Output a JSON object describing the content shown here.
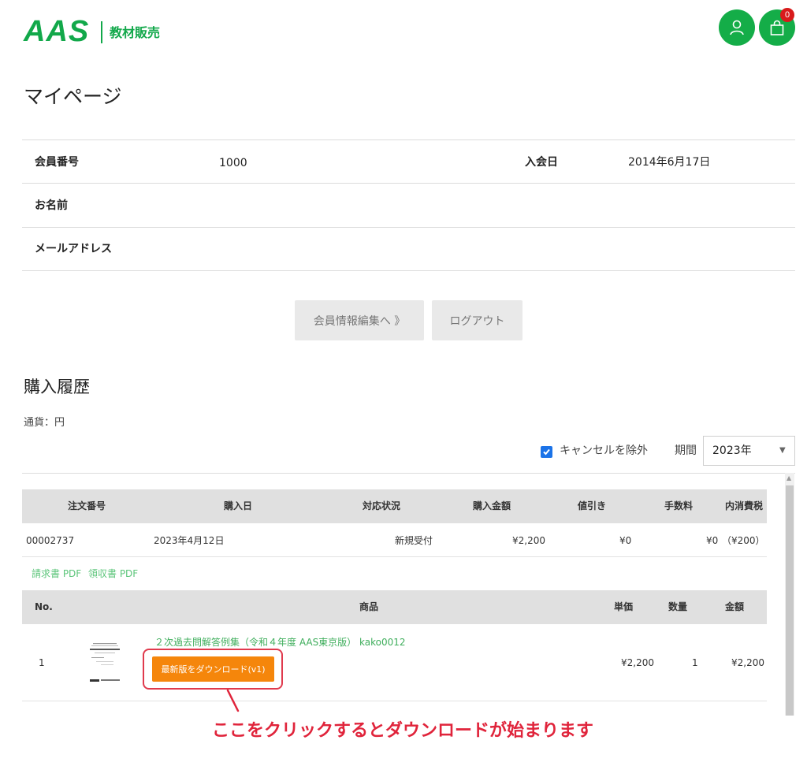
{
  "header": {
    "logo_text": "AAS",
    "logo_subtitle": "教材販売",
    "cart_count": "0",
    "brand_color": "#14ad48",
    "icons": [
      "user-icon",
      "shopping-bag-icon"
    ]
  },
  "page_title": "マイページ",
  "member": {
    "number_label": "会員番号",
    "number_value": "1000",
    "join_label": "入会日",
    "join_value": "2014年6月17日",
    "name_label": "お名前",
    "email_label": "メールアドレス"
  },
  "buttons": {
    "edit_member": "会員情報編集へ 》",
    "logout": "ログアウト"
  },
  "history": {
    "title": "購入履歴",
    "currency": "通貨：円",
    "exclude_cancel_label": "キャンセルを除外",
    "exclude_cancel_checked": true,
    "period_label": "期間",
    "period_value": "2023年",
    "order_columns": [
      "注文番号",
      "購入日",
      "対応状況",
      "購入金額",
      "値引き",
      "手数料",
      "内消費税"
    ],
    "order": {
      "number": "00002737",
      "date": "2023年4月12日",
      "status": "新規受付",
      "amount": "¥2,200",
      "discount": "¥0",
      "fee": "¥0",
      "tax": "（¥200）"
    },
    "invoice_link": "請求書 PDF",
    "receipt_link": "領収書 PDF",
    "item_columns": [
      "No.",
      "商品",
      "単価",
      "数量",
      "金額"
    ],
    "item": {
      "no": "1",
      "name": "２次過去問解答例集（令和４年度 AAS東京版） kako0012",
      "download_label": "最新版をダウンロード(v1)",
      "unit_price": "¥2,200",
      "quantity": "1",
      "total": "¥2,200"
    }
  },
  "annotation": "ここをクリックするとダウンロードが始まります",
  "colors": {
    "accent_green": "#14ad48",
    "download_orange": "#f5860b",
    "annotation_red": "#e0243b",
    "badge_red": "#d81b1b"
  }
}
